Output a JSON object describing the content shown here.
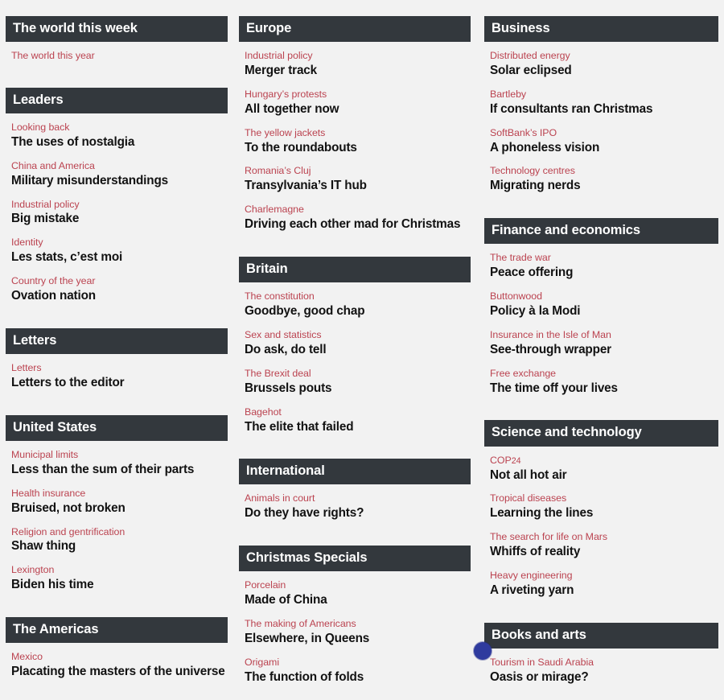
{
  "theme": {
    "page_background": "#f2f2f2",
    "header_background": "#33383d",
    "header_text": "#ffffff",
    "kicker_color": "#bb4350",
    "headline_color": "#121212",
    "marker_color": "#2f3b9e"
  },
  "columns": [
    {
      "name": "column-one",
      "sections": [
        {
          "title": "The world this week",
          "articles": [
            {
              "kicker": "The world this year",
              "headline": ""
            }
          ]
        },
        {
          "title": "Leaders",
          "articles": [
            {
              "kicker": "Looking back",
              "headline": "The uses of nostalgia"
            },
            {
              "kicker": "China and America",
              "headline": "Military misunderstandings"
            },
            {
              "kicker": "Industrial policy",
              "headline": "Big mistake"
            },
            {
              "kicker": "Identity",
              "headline": "Les stats, c’est moi"
            },
            {
              "kicker": "Country of the year",
              "headline": "Ovation nation"
            }
          ]
        },
        {
          "title": "Letters",
          "articles": [
            {
              "kicker": "Letters",
              "headline": "Letters to the editor"
            }
          ]
        },
        {
          "title": "United States",
          "articles": [
            {
              "kicker": "Municipal limits",
              "headline": "Less than the sum of their parts"
            },
            {
              "kicker": "Health insurance",
              "headline": "Bruised, not broken"
            },
            {
              "kicker": "Religion and gentrification",
              "headline": "Shaw thing"
            },
            {
              "kicker": "Lexington",
              "headline": "Biden his time"
            }
          ]
        },
        {
          "title": "The Americas",
          "articles": [
            {
              "kicker": "Mexico",
              "headline": "Placating the masters of the universe"
            }
          ]
        }
      ]
    },
    {
      "name": "column-two",
      "sections": [
        {
          "title": "Europe",
          "articles": [
            {
              "kicker": "Industrial policy",
              "headline": "Merger track"
            },
            {
              "kicker": "Hungary’s protests",
              "headline": "All together now"
            },
            {
              "kicker": "The yellow jackets",
              "headline": "To the roundabouts"
            },
            {
              "kicker": "Romania’s Cluj",
              "headline": "Transylvania’s IT hub"
            },
            {
              "kicker": "Charlemagne",
              "headline": "Driving each other mad for Christmas"
            }
          ]
        },
        {
          "title": "Britain",
          "articles": [
            {
              "kicker": "The constitution",
              "headline": "Goodbye, good chap"
            },
            {
              "kicker": "Sex and statistics",
              "headline": "Do ask, do tell"
            },
            {
              "kicker": "The Brexit deal",
              "headline": "Brussels pouts"
            },
            {
              "kicker": "Bagehot",
              "headline": "The elite that failed"
            }
          ]
        },
        {
          "title": "International",
          "articles": [
            {
              "kicker": "Animals in court",
              "headline": "Do they have rights?"
            }
          ]
        },
        {
          "title": "Christmas Specials",
          "articles": [
            {
              "kicker": "Porcelain",
              "headline": "Made of China"
            },
            {
              "kicker": "The making of Americans",
              "headline": "Elsewhere, in Queens"
            },
            {
              "kicker": "Origami",
              "headline": "The function of folds"
            }
          ]
        }
      ]
    },
    {
      "name": "column-three",
      "sections": [
        {
          "title": "Business",
          "articles": [
            {
              "kicker": "Distributed energy",
              "headline": "Solar eclipsed"
            },
            {
              "kicker": "Bartleby",
              "headline": "If consultants ran Christmas"
            },
            {
              "kicker": "SoftBank’s IPO",
              "headline": "A phoneless vision"
            },
            {
              "kicker": "Technology centres",
              "headline": "Migrating nerds"
            }
          ]
        },
        {
          "title": "Finance and economics",
          "articles": [
            {
              "kicker": "The trade war",
              "headline": "Peace offering"
            },
            {
              "kicker": "Buttonwood",
              "headline": "Policy à la Modi"
            },
            {
              "kicker": "Insurance in the Isle of Man",
              "headline": "See-through wrapper"
            },
            {
              "kicker": "Free exchange",
              "headline": "The time off your lives"
            }
          ]
        },
        {
          "title": "Science and technology",
          "articles": [
            {
              "kicker": "COP24",
              "headline": "Not all hot air"
            },
            {
              "kicker": "Tropical diseases",
              "headline": "Learning the lines"
            },
            {
              "kicker": "The search for life on Mars",
              "headline": "Whiffs of reality"
            },
            {
              "kicker": "Heavy engineering",
              "headline": "A riveting yarn"
            }
          ]
        },
        {
          "title": "Books and arts",
          "articles": [
            {
              "kicker": "Tourism in Saudi Arabia",
              "headline": "Oasis or mirage?"
            }
          ]
        }
      ]
    }
  ],
  "floating_marker": {
    "icon": "blue-circle-badge"
  }
}
